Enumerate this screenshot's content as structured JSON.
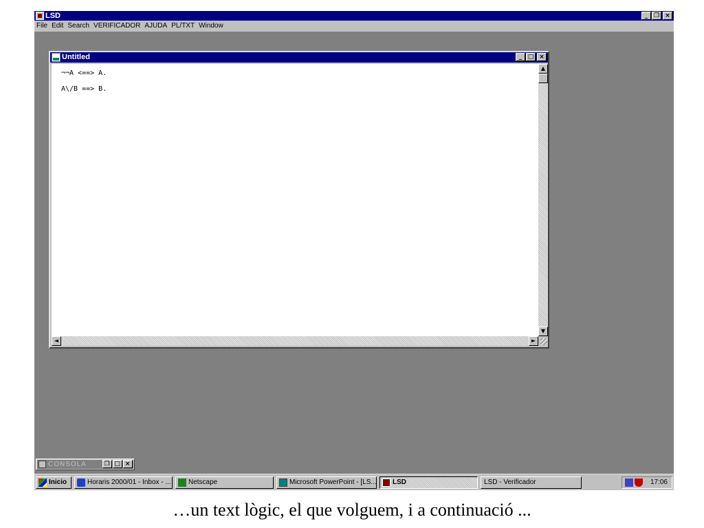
{
  "app": {
    "title": "LSD",
    "menu": [
      "File",
      "Edit",
      "Search",
      "VERIFICADOR",
      "AJUDA",
      "PL/TXT",
      "Window"
    ]
  },
  "document": {
    "title": "Untitled",
    "lines": [
      "¬¬A <==> A.",
      "A\\/B ==> B."
    ]
  },
  "console": {
    "title": "CONSOLA"
  },
  "taskbar": {
    "start_label": "Inicio",
    "buttons": [
      {
        "label": "Horaris 2000/01 - Inbox - ...",
        "icon": "mail-icon"
      },
      {
        "label": "Netscape",
        "icon": "netscape-icon"
      },
      {
        "label": "Microsoft PowerPoint - [LS...",
        "icon": "powerpoint-icon"
      },
      {
        "label": "LSD",
        "icon": "lsd-app-icon"
      },
      {
        "label": "LSD - Verificador",
        "icon": ""
      }
    ],
    "clock": "17:06"
  },
  "caption": "…un text lògic, el que volguem, i a continuació ..."
}
